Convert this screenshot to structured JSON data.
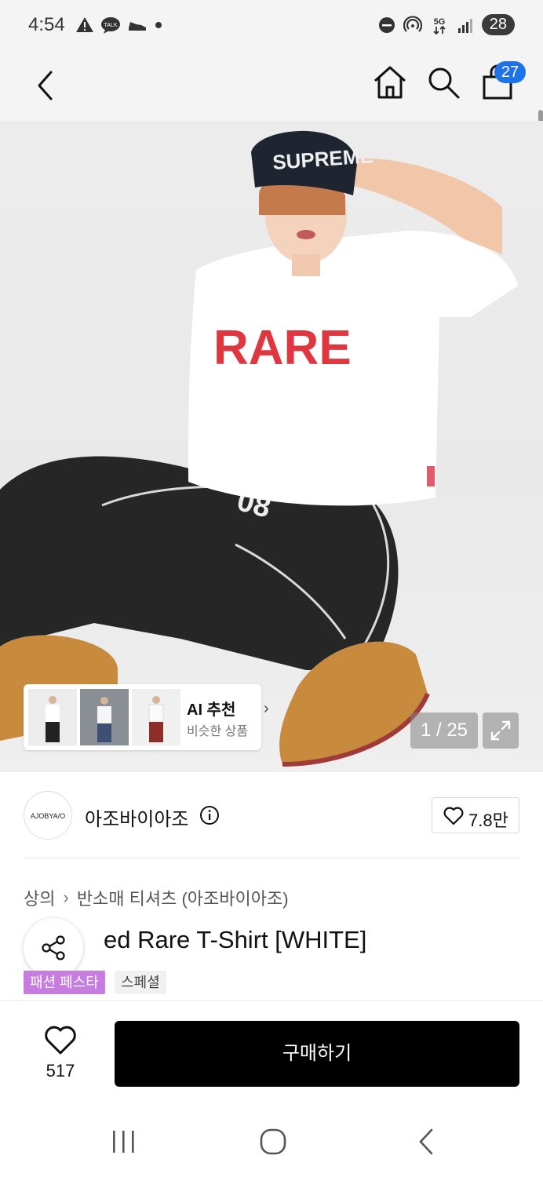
{
  "status_bar": {
    "time": "4:54",
    "battery": "28",
    "icons": [
      "warning-icon",
      "talk-icon",
      "shoe-icon",
      "dot-icon",
      "dnd-icon",
      "hotspot-icon",
      "5g-icon",
      "signal-icon"
    ],
    "talk_label": "TALK",
    "network_label": "5G"
  },
  "header": {
    "cart_badge": "27"
  },
  "gallery": {
    "counter": "1 / 25",
    "ai_title": "AI 추천",
    "ai_subtitle": "비슷한 상품",
    "shirt_print": "RARE",
    "cap_print": "SUPREME"
  },
  "brand": {
    "logo_text": "AJOBYA/O",
    "name": "아조바이아조",
    "likes": "7.8만"
  },
  "breadcrumb": {
    "category": "상의",
    "subcategory": "반소매 티셔츠 (아조바이아조)"
  },
  "product": {
    "title": "ed Rare T-Shirt [WHITE]",
    "tags": [
      "패션 페스타",
      "스페셜"
    ]
  },
  "buy_bar": {
    "wish_count": "517",
    "buy_label": "구매하기"
  },
  "colors": {
    "accent": "#1e73e8",
    "tag_purple": "#c77ce0",
    "buy_button": "#000000"
  }
}
